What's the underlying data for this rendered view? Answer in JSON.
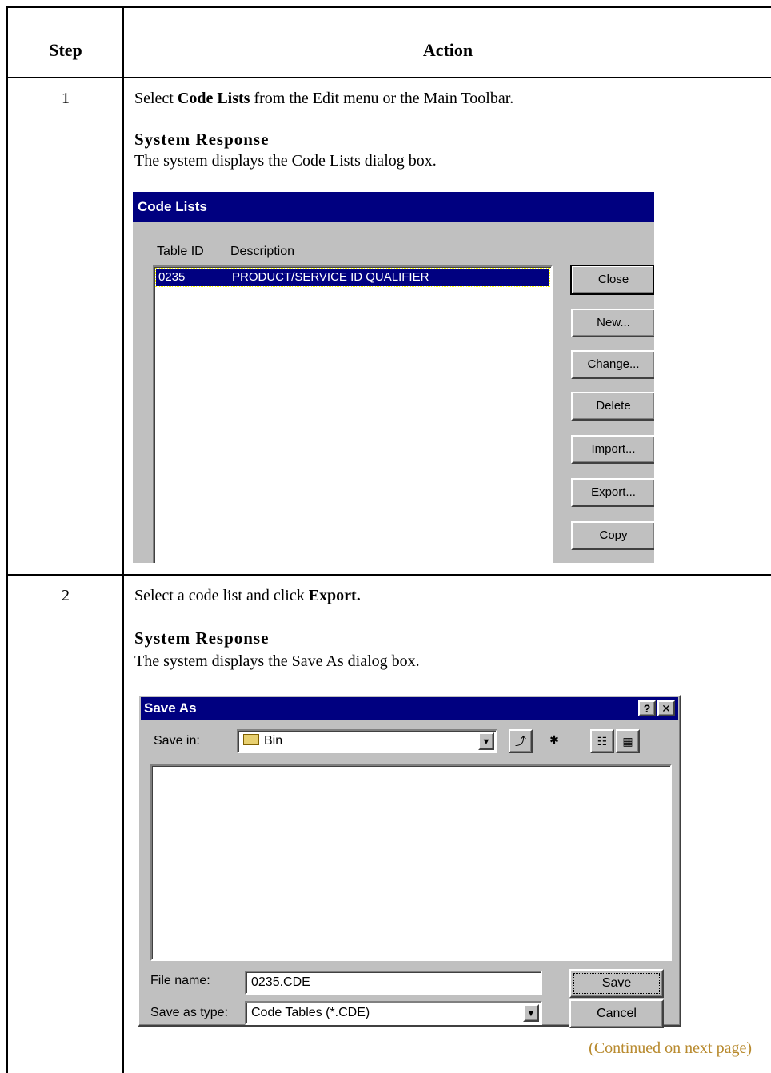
{
  "table": {
    "header_step": "Step",
    "header_action": "Action",
    "rows": [
      {
        "step": "1",
        "instruction_pre": "Select ",
        "instruction_bold": "Code Lists",
        "instruction_post": " from the Edit menu or the Main Toolbar.",
        "response_title": "System Response",
        "response_text": "The system displays the Code Lists dialog box."
      },
      {
        "step": "2",
        "instruction_pre": "Select a code list and click ",
        "instruction_bold": "Export.",
        "instruction_post": "",
        "response_title": "System Response",
        "response_text": "The system displays the Save As dialog box."
      }
    ],
    "continued": "(Continued on next page)"
  },
  "code_lists_dialog": {
    "title": "Code Lists",
    "col_table_id": "Table ID",
    "col_description": "Description",
    "selected_row": {
      "table_id": "0235",
      "description": "PRODUCT/SERVICE ID QUALIFIER"
    },
    "buttons": [
      "Close",
      "New...",
      "Change...",
      "Delete",
      "Import...",
      "Export...",
      "Copy"
    ]
  },
  "save_as_dialog": {
    "title": "Save As",
    "help_label": "?",
    "close_label": "✕",
    "save_in_label": "Save in:",
    "save_in_value": "Bin",
    "file_name_label": "File name:",
    "file_name_value": "0235.CDE",
    "save_as_type_label": "Save as type:",
    "save_as_type_value": "Code Tables (*.CDE)",
    "save_button": "Save",
    "cancel_button": "Cancel",
    "icons": [
      "folder-icon",
      "up-one-level-icon",
      "new-folder-icon",
      "list-view-icon",
      "details-view-icon"
    ]
  }
}
